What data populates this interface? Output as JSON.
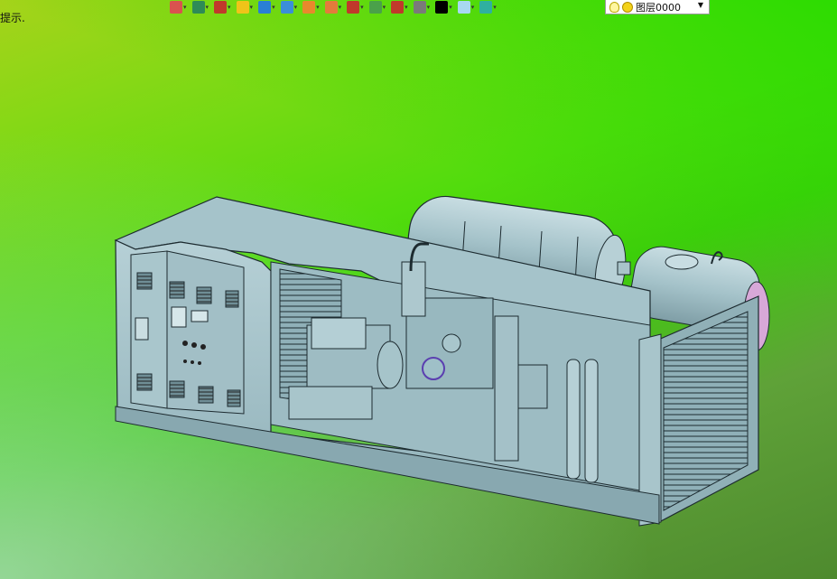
{
  "status": {
    "prompt_text": "提示."
  },
  "toolbar": {
    "buttons": [
      {
        "icon": "import-icon",
        "color": "#d9534f"
      },
      {
        "icon": "layers-icon",
        "color": "#2e8b57"
      },
      {
        "icon": "pencil-icon",
        "color": "#c0392b"
      },
      {
        "icon": "box-yellow-icon",
        "color": "#f0c419"
      },
      {
        "icon": "cube-blue-icon",
        "color": "#2a7fd4"
      },
      {
        "icon": "cube-stack-icon",
        "color": "#3b8ed8"
      },
      {
        "icon": "render-ball-icon",
        "color": "#e8892c"
      },
      {
        "icon": "clock-icon",
        "color": "#e37b3b"
      },
      {
        "icon": "target-icon",
        "color": "#c0392b"
      },
      {
        "icon": "phone-icon",
        "color": "#4aa14a"
      },
      {
        "icon": "frame-icon",
        "color": "#c0392b"
      },
      {
        "icon": "monitor-icon",
        "color": "#7a7a7a"
      },
      {
        "icon": "line-style-icon",
        "color": "#000000"
      },
      {
        "icon": "color-swatch-icon",
        "color": "#a8d8f0"
      },
      {
        "icon": "layer-stack-icon",
        "color": "#2fb0a0"
      }
    ]
  },
  "layer": {
    "name": "图层0000"
  }
}
